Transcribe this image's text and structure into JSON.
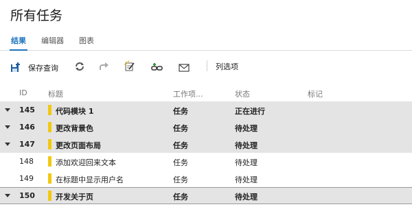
{
  "title": "所有任务",
  "tabs": [
    {
      "label": "结果"
    },
    {
      "label": "编辑器"
    },
    {
      "label": "图表"
    }
  ],
  "toolbar": {
    "save_query": "保存查询",
    "column_options": "列选项"
  },
  "colors": {
    "accent": "#1e73be",
    "task_bar": "#f2c811",
    "selected_row": "#e4e4e4"
  },
  "columns": {
    "id": "ID",
    "title": "标题",
    "work_item_type": "工作项...",
    "state": "状态",
    "tags": "标记"
  },
  "rows": [
    {
      "id": "145",
      "title": "代码模块 1",
      "type": "任务",
      "state": "正在进行"
    },
    {
      "id": "146",
      "title": "更改背景色",
      "type": "任务",
      "state": "待处理"
    },
    {
      "id": "147",
      "title": "更改页面布局",
      "type": "任务",
      "state": "待处理"
    },
    {
      "id": "148",
      "title": "添加欢迎回来文本",
      "type": "任务",
      "state": "待处理"
    },
    {
      "id": "149",
      "title": "在标题中显示用户名",
      "type": "任务",
      "state": "待处理"
    },
    {
      "id": "150",
      "title": "开发关于页",
      "type": "任务",
      "state": "待处理"
    }
  ]
}
